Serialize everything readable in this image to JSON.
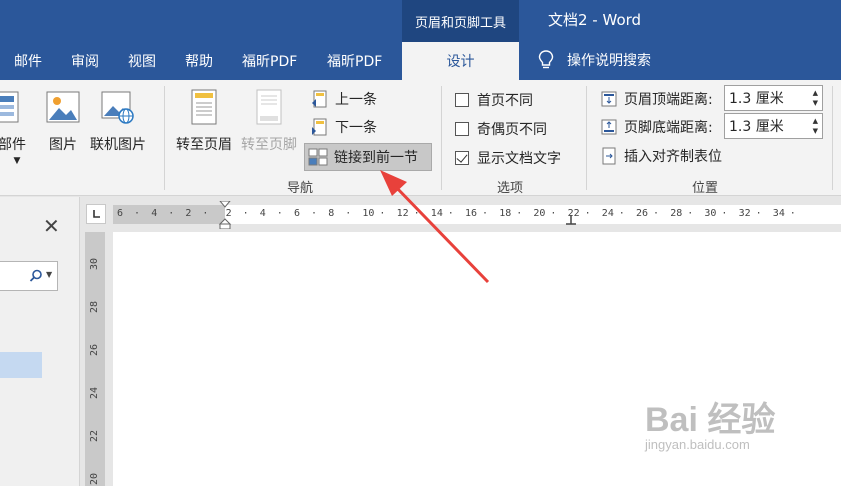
{
  "titlebar": {
    "context_tool": "页眉和页脚工具",
    "doc_title": "文档2 - Word",
    "tabs": [
      "邮件",
      "审阅",
      "视图",
      "帮助",
      "福昕PDF",
      "福昕PDF"
    ],
    "active_tab": "设计",
    "tell_me": "操作说明搜索"
  },
  "ribbon": {
    "insert_group": {
      "parts_label": "部件",
      "picture_label": "图片",
      "online_picture_label": "联机图片"
    },
    "navigation": {
      "goto_header": "转至页眉",
      "goto_footer": "转至页脚",
      "previous": "上一条",
      "next": "下一条",
      "link_to_previous": "链接到前一节",
      "group_label": "导航"
    },
    "options": {
      "different_first_page": "首页不同",
      "different_odd_even": "奇偶页不同",
      "show_document_text": "显示文档文字",
      "checked": [
        false,
        false,
        true
      ],
      "group_label": "选项"
    },
    "position": {
      "header_from_top_label": "页眉顶端距离:",
      "header_from_top_value": "1.3 厘米",
      "footer_from_bottom_label": "页脚底端距离:",
      "footer_from_bottom_value": "1.3 厘米",
      "insert_alignment_tab": "插入对齐制表位",
      "group_label": "位置"
    }
  },
  "nav_pane": {
    "close": "✕"
  },
  "ruler": {
    "horizontal_ticks": [
      "6",
      "4",
      "2",
      "2",
      "4",
      "6",
      "8",
      "10",
      "12",
      "14",
      "16",
      "18",
      "20",
      "22",
      "24",
      "26",
      "28",
      "30",
      "32",
      "34"
    ],
    "vertical_ticks": [
      "30",
      "28",
      "26",
      "24",
      "22",
      "20"
    ]
  },
  "watermark": {
    "brand": "Bai 经验",
    "url": "jingyan.baidu.com"
  },
  "colors": {
    "word_blue": "#2b579a",
    "context_tab": "#1f4680",
    "arrow": "#e8413b"
  }
}
